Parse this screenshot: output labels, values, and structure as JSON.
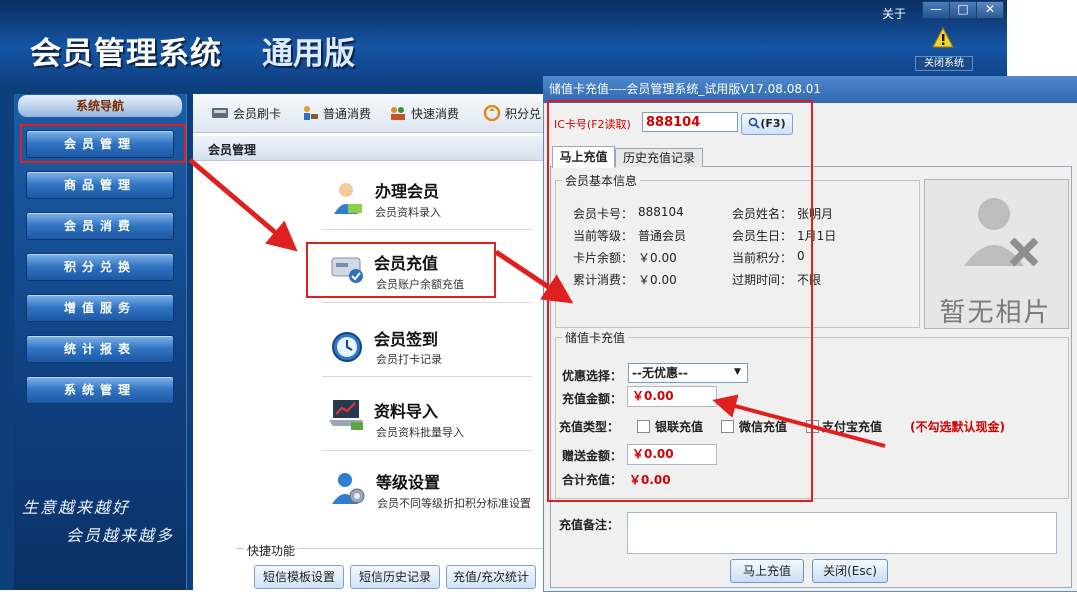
{
  "app": {
    "title": "会员管理系统",
    "edition": "通用版",
    "about": "关于",
    "close_system": "关闭系统",
    "window_min": "—",
    "window_max": "□",
    "window_close": "✕"
  },
  "sidebar": {
    "header": "系统导航",
    "items": [
      "会员管理",
      "商品管理",
      "会员消费",
      "积分兑换",
      "增值服务",
      "统计报表",
      "系统管理"
    ],
    "slogan_line1": "生意越来越好",
    "slogan_line2": "会员越来越多"
  },
  "toolbar": {
    "items": [
      "会员刷卡",
      "普通消费",
      "快速消费",
      "积分兑"
    ]
  },
  "breadcrumb": "会员管理",
  "features": [
    {
      "title": "办理会员",
      "desc": "会员资料录入",
      "icon": "user-add-icon"
    },
    {
      "title": "会员充值",
      "desc": "会员账户余额充值",
      "icon": "card-recharge-icon"
    },
    {
      "title": "会员签到",
      "desc": "会员打卡记录",
      "icon": "clock-icon"
    },
    {
      "title": "资料导入",
      "desc": "会员资料批量导入",
      "icon": "laptop-chart-icon"
    },
    {
      "title": "等级设置",
      "desc": "会员不同等级折扣积分标准设置",
      "icon": "user-settings-icon"
    }
  ],
  "quick": {
    "label": "快捷功能",
    "buttons": [
      "短信模板设置",
      "短信历史记录",
      "充值/充次统计"
    ]
  },
  "dialog": {
    "title": "储值卡充值----会员管理系统_试用版V17.08.08.01",
    "ic_label": "IC卡号(F2读取)",
    "ic_value": "888104",
    "ic_button": "(F3)",
    "tabs": [
      "马上充值",
      "历史充值记录"
    ],
    "member_group_title": "会员基本信息",
    "member_info": {
      "card_no_label": "会员卡号：",
      "card_no": "888104",
      "name_label": "会员姓名：",
      "name": "张明月",
      "level_label": "当前等级：",
      "level": "普通会员",
      "birthday_label": "会员生日：",
      "birthday": "1月1日",
      "balance_label": "卡片余额：",
      "balance": "￥0.00",
      "points_label": "当前积分：",
      "points": "0",
      "total_label": "累计消费：",
      "total": "￥0.00",
      "expire_label": "过期时间：",
      "expire": "不限"
    },
    "photo_text": "暂无相片",
    "recharge_group_title": "储值卡充值",
    "discount_label": "优惠选择：",
    "discount_value": "--无优惠--",
    "amount_label": "充值金额：",
    "amount_value": "￥0.00",
    "type_label": "充值类型：",
    "types": [
      "银联充值",
      "微信充值",
      "支付宝充值"
    ],
    "type_note": "(不勾选默认现金)",
    "gift_label": "赠送金额：",
    "gift_value": "￥0.00",
    "total_label": "合计充值：",
    "total_value": "￥0.00",
    "remark_label": "充值备注：",
    "btn_confirm": "马上充值",
    "btn_close": "关闭(Esc)"
  },
  "colors": {
    "title_band": "#1555a3",
    "nav_button": "#2f73c1",
    "highlight_red": "#e0201e",
    "amount_red": "#d40000"
  }
}
